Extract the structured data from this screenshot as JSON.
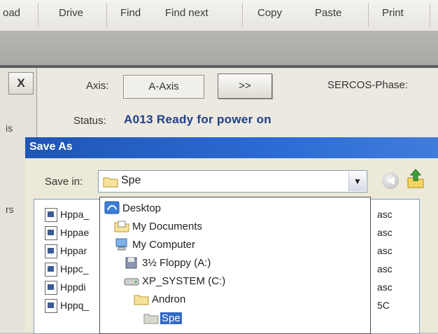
{
  "toolbar": {
    "items": [
      {
        "label": "oad"
      },
      {
        "label": "Drive"
      },
      {
        "label": "Find"
      },
      {
        "label": "Find next"
      },
      {
        "label": "Copy"
      },
      {
        "label": "Paste"
      },
      {
        "label": "Print"
      }
    ]
  },
  "left_panel": {
    "close_label": "X",
    "text1": "is",
    "text2": "rs"
  },
  "main": {
    "axis_label": "Axis:",
    "axis_value": "A-Axis",
    "next_button": ">>",
    "sercos_label": "SERCOS-Phase:",
    "status_label": "Status:",
    "status_value": "A013 Ready for power on"
  },
  "dialog": {
    "title": "Save As",
    "save_in_label": "Save in:",
    "save_in_value": "Spe",
    "files": [
      {
        "name": "Hppa_"
      },
      {
        "name": "Hppae"
      },
      {
        "name": "Hppar"
      },
      {
        "name": "Hppc_"
      },
      {
        "name": "Hppdi"
      },
      {
        "name": "Hppq_"
      }
    ],
    "file_ext": [
      "asc",
      "asc",
      "asc",
      "asc",
      "asc",
      "5C"
    ],
    "dropdown": [
      {
        "label": "Desktop",
        "icon": "desktop-icon"
      },
      {
        "label": "My Documents",
        "icon": "my-documents-icon"
      },
      {
        "label": "My Computer",
        "icon": "my-computer-icon"
      },
      {
        "label": "3½ Floppy (A:)",
        "icon": "floppy-icon"
      },
      {
        "label": "XP_SYSTEM (C:)",
        "icon": "hard-drive-icon"
      },
      {
        "label": "Andron",
        "icon": "folder-icon"
      },
      {
        "label": "Spe",
        "icon": "folder-icon"
      }
    ]
  },
  "colors": {
    "title_bar": "#2c6bd3",
    "status_text": "#1d3f8a",
    "selection": "#316ac5"
  }
}
